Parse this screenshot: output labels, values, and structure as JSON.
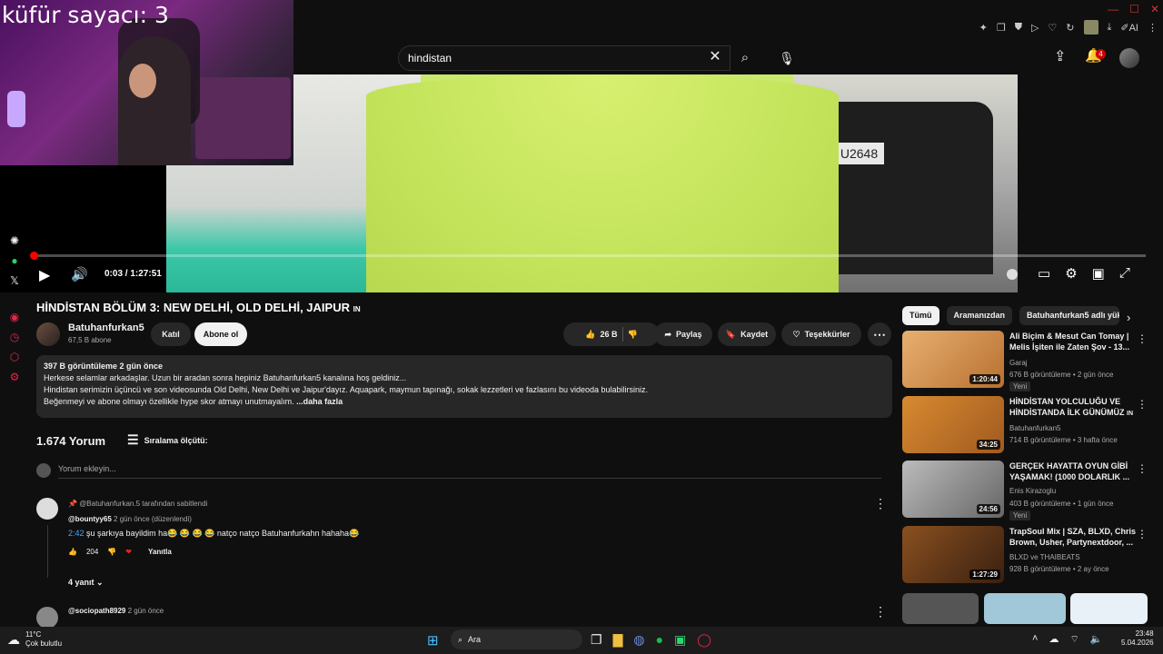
{
  "overlay": {
    "swear_counter": "küfür sayacı: 3"
  },
  "search": {
    "query": "hindistan",
    "clear_icon": "close-icon",
    "search_icon": "search-icon",
    "mic_icon": "mic-icon"
  },
  "header": {
    "notifications_count": "4"
  },
  "player": {
    "time": "0:03 / 1:27:51",
    "plate": "U2648",
    "progress": 0.002
  },
  "video": {
    "title": "HİNDİSTAN BÖLÜM 3: NEW DELHİ, OLD DELHİ, JAIPUR",
    "title_flag": "IN",
    "channel": "Batuhanfurkan5",
    "subscribers": "67,5 B abone",
    "join_label": "Katıl",
    "subscribe_label": "Abone ol",
    "likes": "26 B",
    "share_label": "Paylaş",
    "save_label": "Kaydet",
    "thanks_label": "Teşekkürler"
  },
  "description": {
    "meta": "397 B görüntüleme  2 gün önce",
    "line1": "Herkese selamlar arkadaşlar. Uzun bir aradan sonra hepiniz Batuhanfurkan5 kanalına hoş geldiniz...",
    "line2": "Hindistan serimizin üçüncü ve son videosunda Old Delhi, New Delhi ve Jaipur'dayız. Aquapark, maymun tapınağı, sokak lezzetleri ve fazlasını bu videoda bulabilirsiniz.",
    "line3": "Beğenmeyi ve abone olmayı özellikle hype skor atmayı unutmayalım.",
    "more": "...daha fazla"
  },
  "comments": {
    "count": "1.674 Yorum",
    "sort_label": "Sıralama ölçütü:",
    "add_placeholder": "Yorum ekleyin...",
    "items": [
      {
        "pinned": "@Batuhanfurkan.5 tarafından sabitlendi",
        "author": "@bountyy65",
        "time": "2 gün önce (düzenlendi)",
        "timestamp": "2:42",
        "text": "şu şarkıya bayildim ha😂 😂 😂 😂 natço natço Batuhanfurkahn hahaha😂",
        "likes": "204",
        "reply_label": "Yanıtla",
        "replies": "4 yanıt"
      },
      {
        "author": "@sociopath8929",
        "time": "2 gün önce"
      }
    ]
  },
  "chips": [
    "Tümü",
    "Aramanızdan",
    "Batuhanfurkan5 adlı yük"
  ],
  "recommendations": [
    {
      "title": "Ali Biçim & Mesut Can Tomay | Melis İşiten ile Zaten Şov - 13...",
      "channel": "Garaj",
      "meta": "676 B görüntüleme • 2 gün önce",
      "badge": "Yeni",
      "duration": "1:20:44",
      "thumb_color": "#d8a060"
    },
    {
      "title": "HİNDİSTAN YOLCULUĞU VE HİNDİSTANDA İLK GÜNÜMÜZ",
      "title_flag": "IN",
      "channel": "Batuhanfurkan5",
      "meta": "714 B görüntüleme • 3 hafta önce",
      "badge": "",
      "duration": "34:25",
      "thumb_color": "#c87830"
    },
    {
      "title": "GERÇEK HAYATTA OYUN GİBİ YAŞAMAK! (1000 DOLARLIK ...",
      "channel": "Enis Kirazoglu",
      "meta": "403 B görüntüleme • 1 gün önce",
      "badge": "Yeni",
      "duration": "24:56",
      "thumb_color": "#909090"
    },
    {
      "title": "TrapSoul Mix | SZA, BLXD, Chris Brown, Usher, Partynextdoor, ...",
      "channel": "BLXD",
      "channel_extra": "ve THAIBEATS",
      "meta": "928 B görüntüleme • 2 ay önce",
      "badge": "",
      "duration": "1:27:29",
      "thumb_color": "#704020"
    }
  ],
  "taskbar": {
    "temperature": "11°C",
    "weather": "Çok bulutlu",
    "search_label": "Ara",
    "time": "23:48",
    "date": "5.04.2026"
  }
}
